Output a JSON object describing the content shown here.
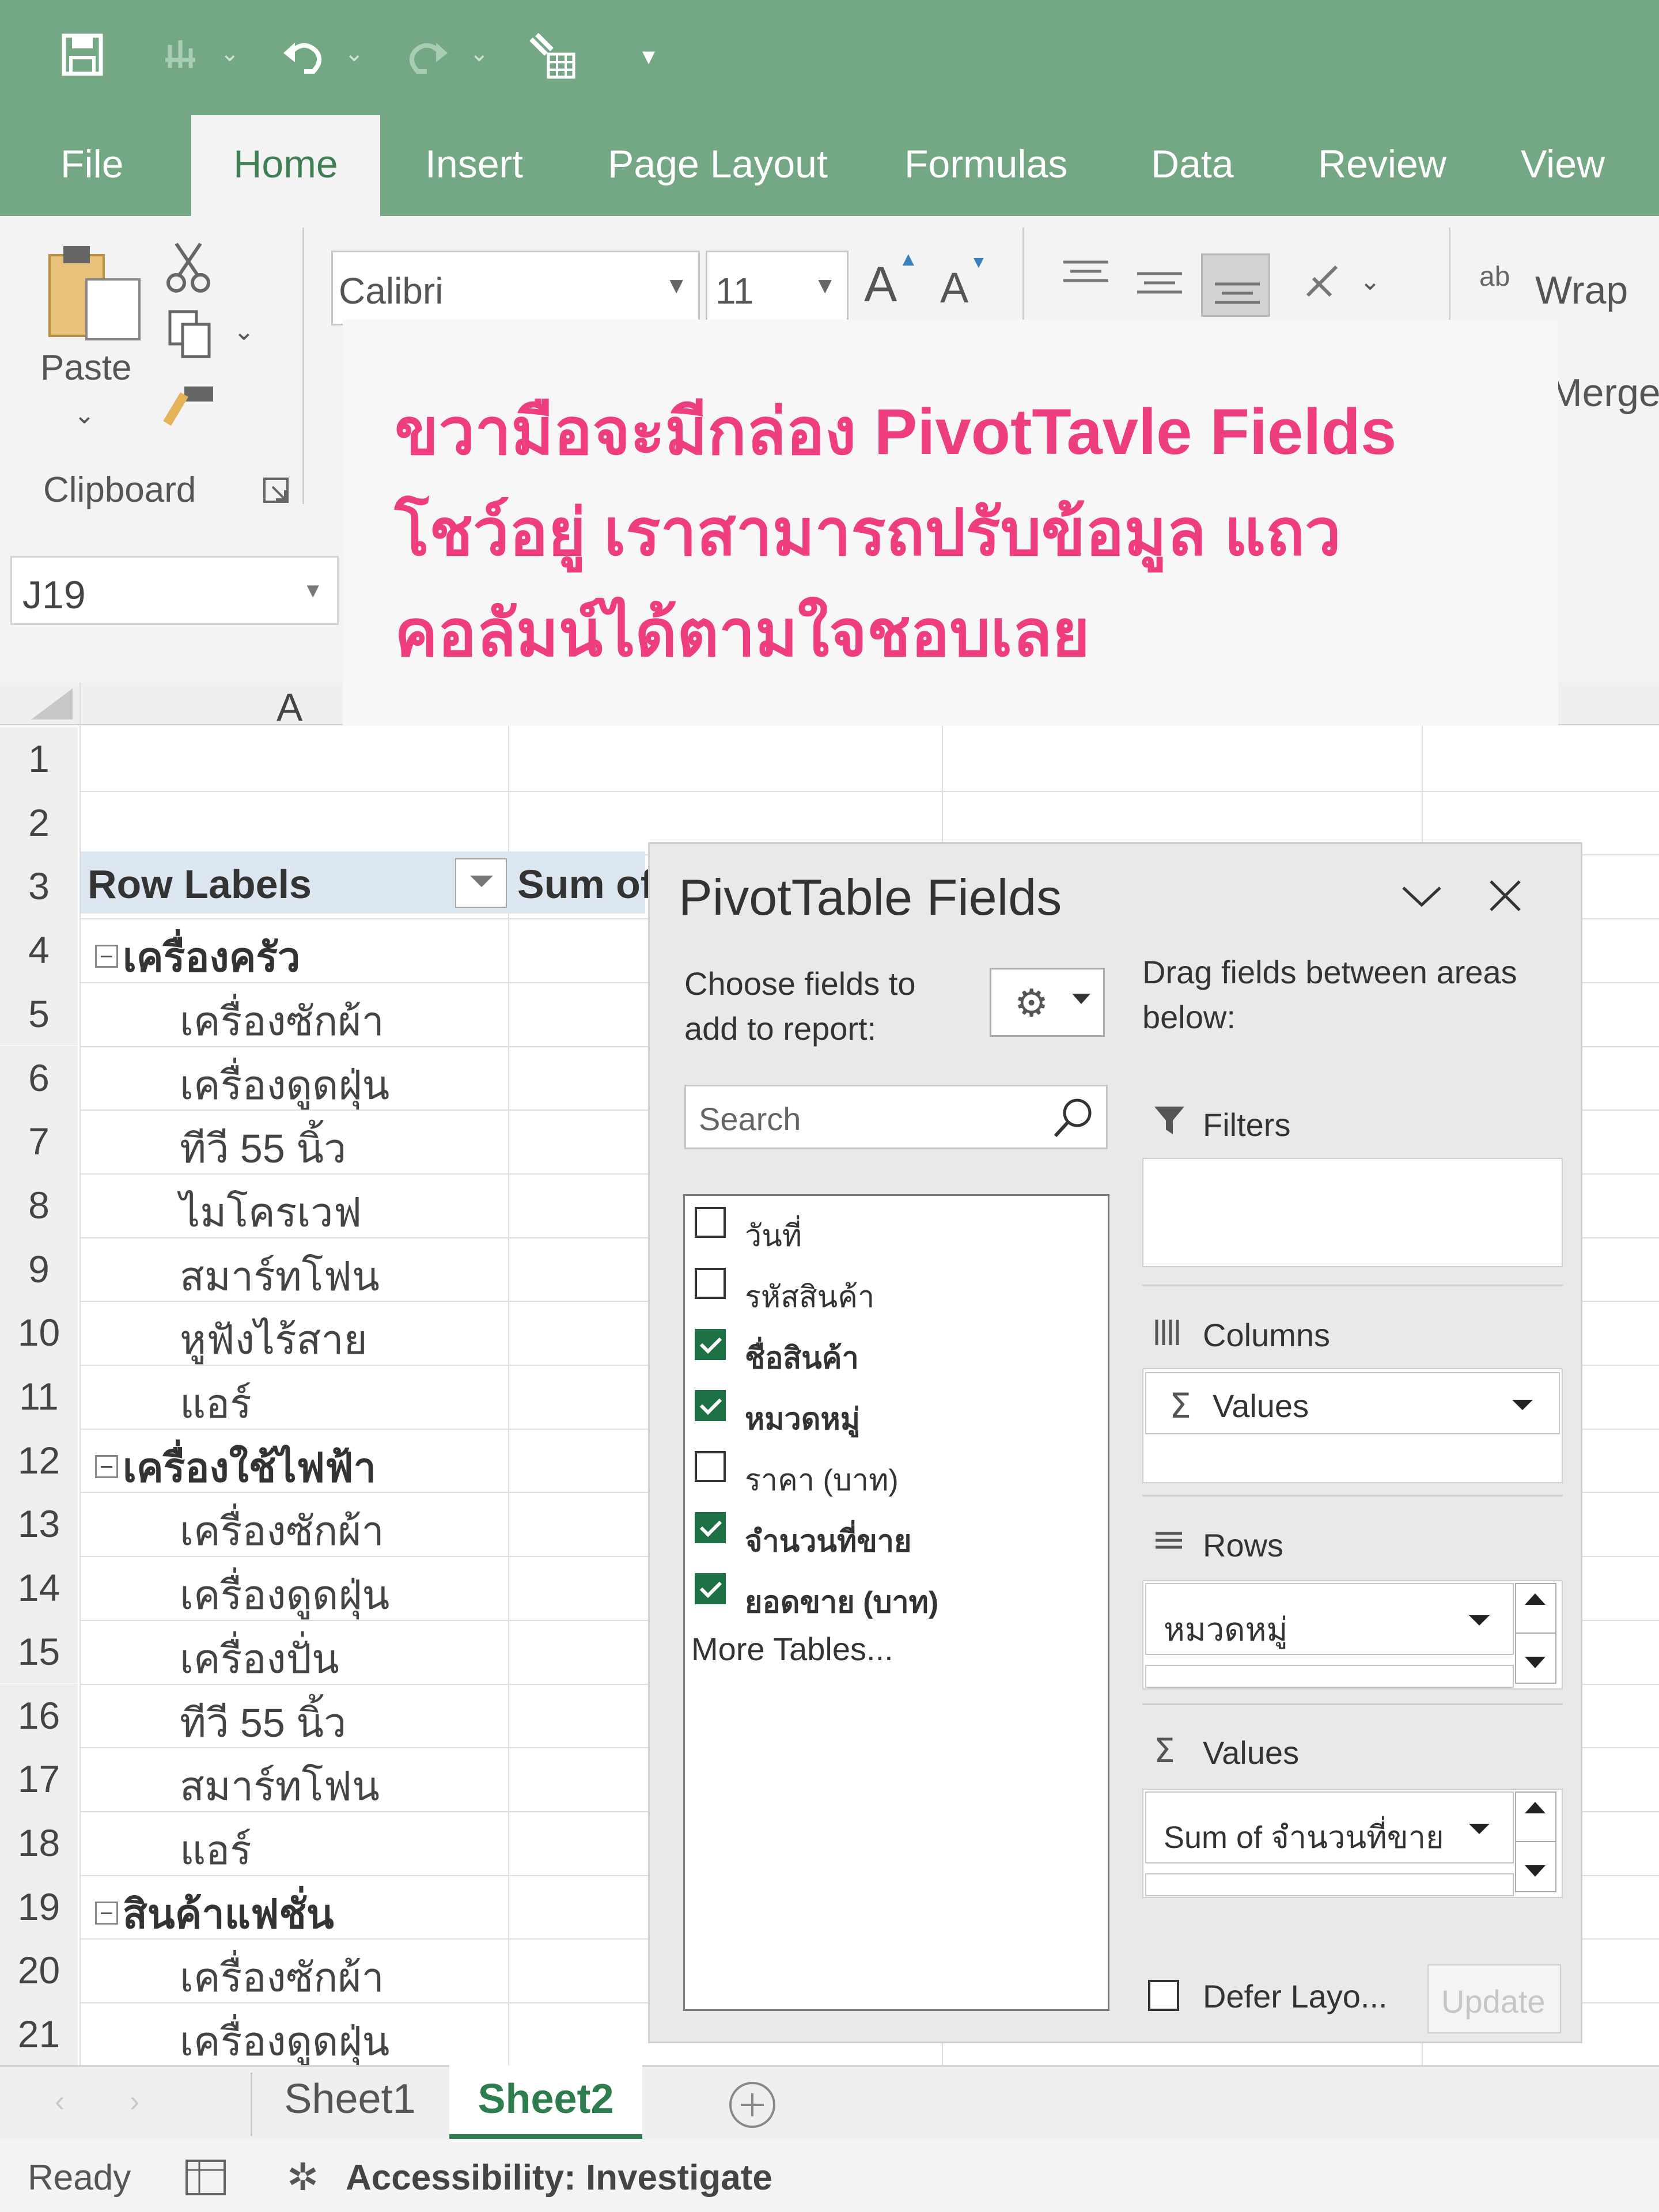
{
  "ribbon_tabs": [
    "File",
    "Home",
    "Insert",
    "Page Layout",
    "Formulas",
    "Data",
    "Review",
    "View"
  ],
  "ribbon": {
    "paste_label": "Paste",
    "clipboard_label": "Clipboard",
    "font_name": "Calibri",
    "font_size": "11",
    "grow_font": "A",
    "shrink_font": "A",
    "wrap_text": "Wrap T",
    "wrap_icon_text": "ab",
    "merge": "Merge"
  },
  "name_box": "J19",
  "column_header": "A",
  "note": {
    "line1": "ขวามือจะมีกล่อง PivotTavle Fields",
    "line2": "โชว์อยู่ เราสามารถปรับข้อมูล แถว",
    "line3": "คอลัมน์ได้ตามใจชอบเลย"
  },
  "grid": {
    "row_numbers": [
      "1",
      "2",
      "3",
      "4",
      "5",
      "6",
      "7",
      "8",
      "9",
      "10",
      "11",
      "12",
      "13",
      "14",
      "15",
      "16",
      "17",
      "18",
      "19",
      "20",
      "21"
    ],
    "header_row_labels": "Row Labels",
    "header_sum": "Sum of",
    "rows": [
      {
        "row": 4,
        "text": "เครื่องครัว",
        "group": true
      },
      {
        "row": 5,
        "text": "เครื่องซักผ้า",
        "group": false
      },
      {
        "row": 6,
        "text": "เครื่องดูดฝุ่น",
        "group": false
      },
      {
        "row": 7,
        "text": "ทีวี 55 นิ้ว",
        "group": false
      },
      {
        "row": 8,
        "text": "ไมโครเวฟ",
        "group": false
      },
      {
        "row": 9,
        "text": "สมาร์ทโฟน",
        "group": false
      },
      {
        "row": 10,
        "text": "หูฟังไร้สาย",
        "group": false
      },
      {
        "row": 11,
        "text": "แอร์",
        "group": false
      },
      {
        "row": 12,
        "text": "เครื่องใช้ไฟฟ้า",
        "group": true
      },
      {
        "row": 13,
        "text": "เครื่องซักผ้า",
        "group": false
      },
      {
        "row": 14,
        "text": "เครื่องดูดฝุ่น",
        "group": false
      },
      {
        "row": 15,
        "text": "เครื่องปั่น",
        "group": false
      },
      {
        "row": 16,
        "text": "ทีวี 55 นิ้ว",
        "group": false
      },
      {
        "row": 17,
        "text": "สมาร์ทโฟน",
        "group": false
      },
      {
        "row": 18,
        "text": "แอร์",
        "group": false
      },
      {
        "row": 19,
        "text": "สินค้าแฟชั่น",
        "group": true
      },
      {
        "row": 20,
        "text": "เครื่องซักผ้า",
        "group": false
      },
      {
        "row": 21,
        "text": "เครื่องดูดฝุ่น",
        "group": false
      }
    ]
  },
  "pivot": {
    "title": "PivotTable Fields",
    "choose_line1": "Choose fields to",
    "choose_line2": "add to report:",
    "search_placeholder": "Search",
    "fields": [
      {
        "label": "วันที่",
        "checked": false
      },
      {
        "label": "รหัสสินค้า",
        "checked": false
      },
      {
        "label": "ชื่อสินค้า",
        "checked": true
      },
      {
        "label": "หมวดหมู่",
        "checked": true
      },
      {
        "label": "ราคา (บาท)",
        "checked": false
      },
      {
        "label": "จำนวนที่ขาย",
        "checked": true
      },
      {
        "label": "ยอดขาย (บาท)",
        "checked": true
      }
    ],
    "more_tables": "More Tables...",
    "drag_line1": "Drag fields between areas",
    "drag_line2": "below:",
    "filters_label": "Filters",
    "columns_label": "Columns",
    "columns_item": "Values",
    "rows_label": "Rows",
    "rows_item": "หมวดหมู่",
    "values_label": "Values",
    "values_item": "Sum of จำนวนที่ขาย",
    "defer_label": "Defer Layo...",
    "update_label": "Update"
  },
  "sheets": [
    "Sheet1",
    "Sheet2"
  ],
  "status": {
    "ready": "Ready",
    "accessibility": "Accessibility: Investigate"
  },
  "colors": {
    "title_bar": "#74a784",
    "active_tab_text": "#3f7f54",
    "note_text": "#ee3e7f",
    "checkbox_checked": "#1e7145",
    "active_sheet": "#2e7d4f"
  }
}
